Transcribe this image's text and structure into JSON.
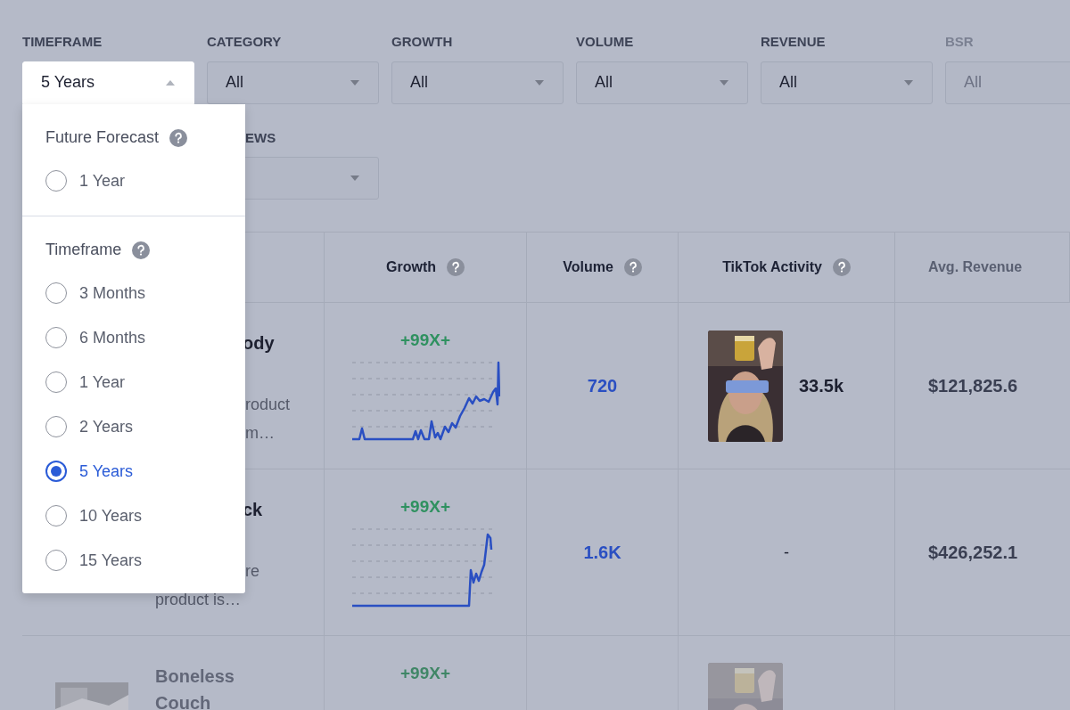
{
  "filters": [
    {
      "label": "TIMEFRAME",
      "value": "5 Years",
      "open": true
    },
    {
      "label": "CATEGORY",
      "value": "All",
      "open": false
    },
    {
      "label": "GROWTH",
      "value": "All",
      "open": false
    },
    {
      "label": "VOLUME",
      "value": "All",
      "open": false
    },
    {
      "label": "REVENUE",
      "value": "All",
      "open": false
    },
    {
      "label": "BSR",
      "value": "All",
      "open": false
    },
    {
      "label": "EWS",
      "open": false
    }
  ],
  "dropdown": {
    "sections": [
      {
        "title": "Future Forecast",
        "options": [
          {
            "label": "1 Year",
            "selected": false
          }
        ]
      },
      {
        "title": "Timeframe",
        "options": [
          {
            "label": "3 Months",
            "selected": false
          },
          {
            "label": "6 Months",
            "selected": false
          },
          {
            "label": "1 Year",
            "selected": false
          },
          {
            "label": "2 Years",
            "selected": false
          },
          {
            "label": "5 Years",
            "selected": true
          },
          {
            "label": "10 Years",
            "selected": false
          },
          {
            "label": "15 Years",
            "selected": false
          }
        ]
      }
    ]
  },
  "table": {
    "columns": [
      {
        "label": "Growth",
        "help": true
      },
      {
        "label": "Volume",
        "help": true
      },
      {
        "label": "TikTok Activity",
        "help": true
      },
      {
        "label": "Avg. Revenue",
        "help": false
      }
    ],
    "rows": [
      {
        "title": [
          "ody"
        ],
        "description": [
          "roduct",
          "m…"
        ],
        "growth": "+99X+",
        "volume": "720",
        "tiktok": {
          "kind": "video",
          "count": "33.5k"
        },
        "revenue": "$121,825.6"
      },
      {
        "title": [
          "ck"
        ],
        "description": [
          "re",
          "product is…"
        ],
        "growth": "+99X+",
        "volume": "1.6K",
        "tiktok": {
          "kind": "none",
          "text": "-"
        },
        "revenue": "$426,252.1"
      },
      {
        "thumbnail": {
          "kind": "picture"
        },
        "title": [
          "Boneless",
          "Couch"
        ],
        "growth": "+99X+",
        "tiktok": {
          "kind": "video"
        }
      }
    ]
  }
}
